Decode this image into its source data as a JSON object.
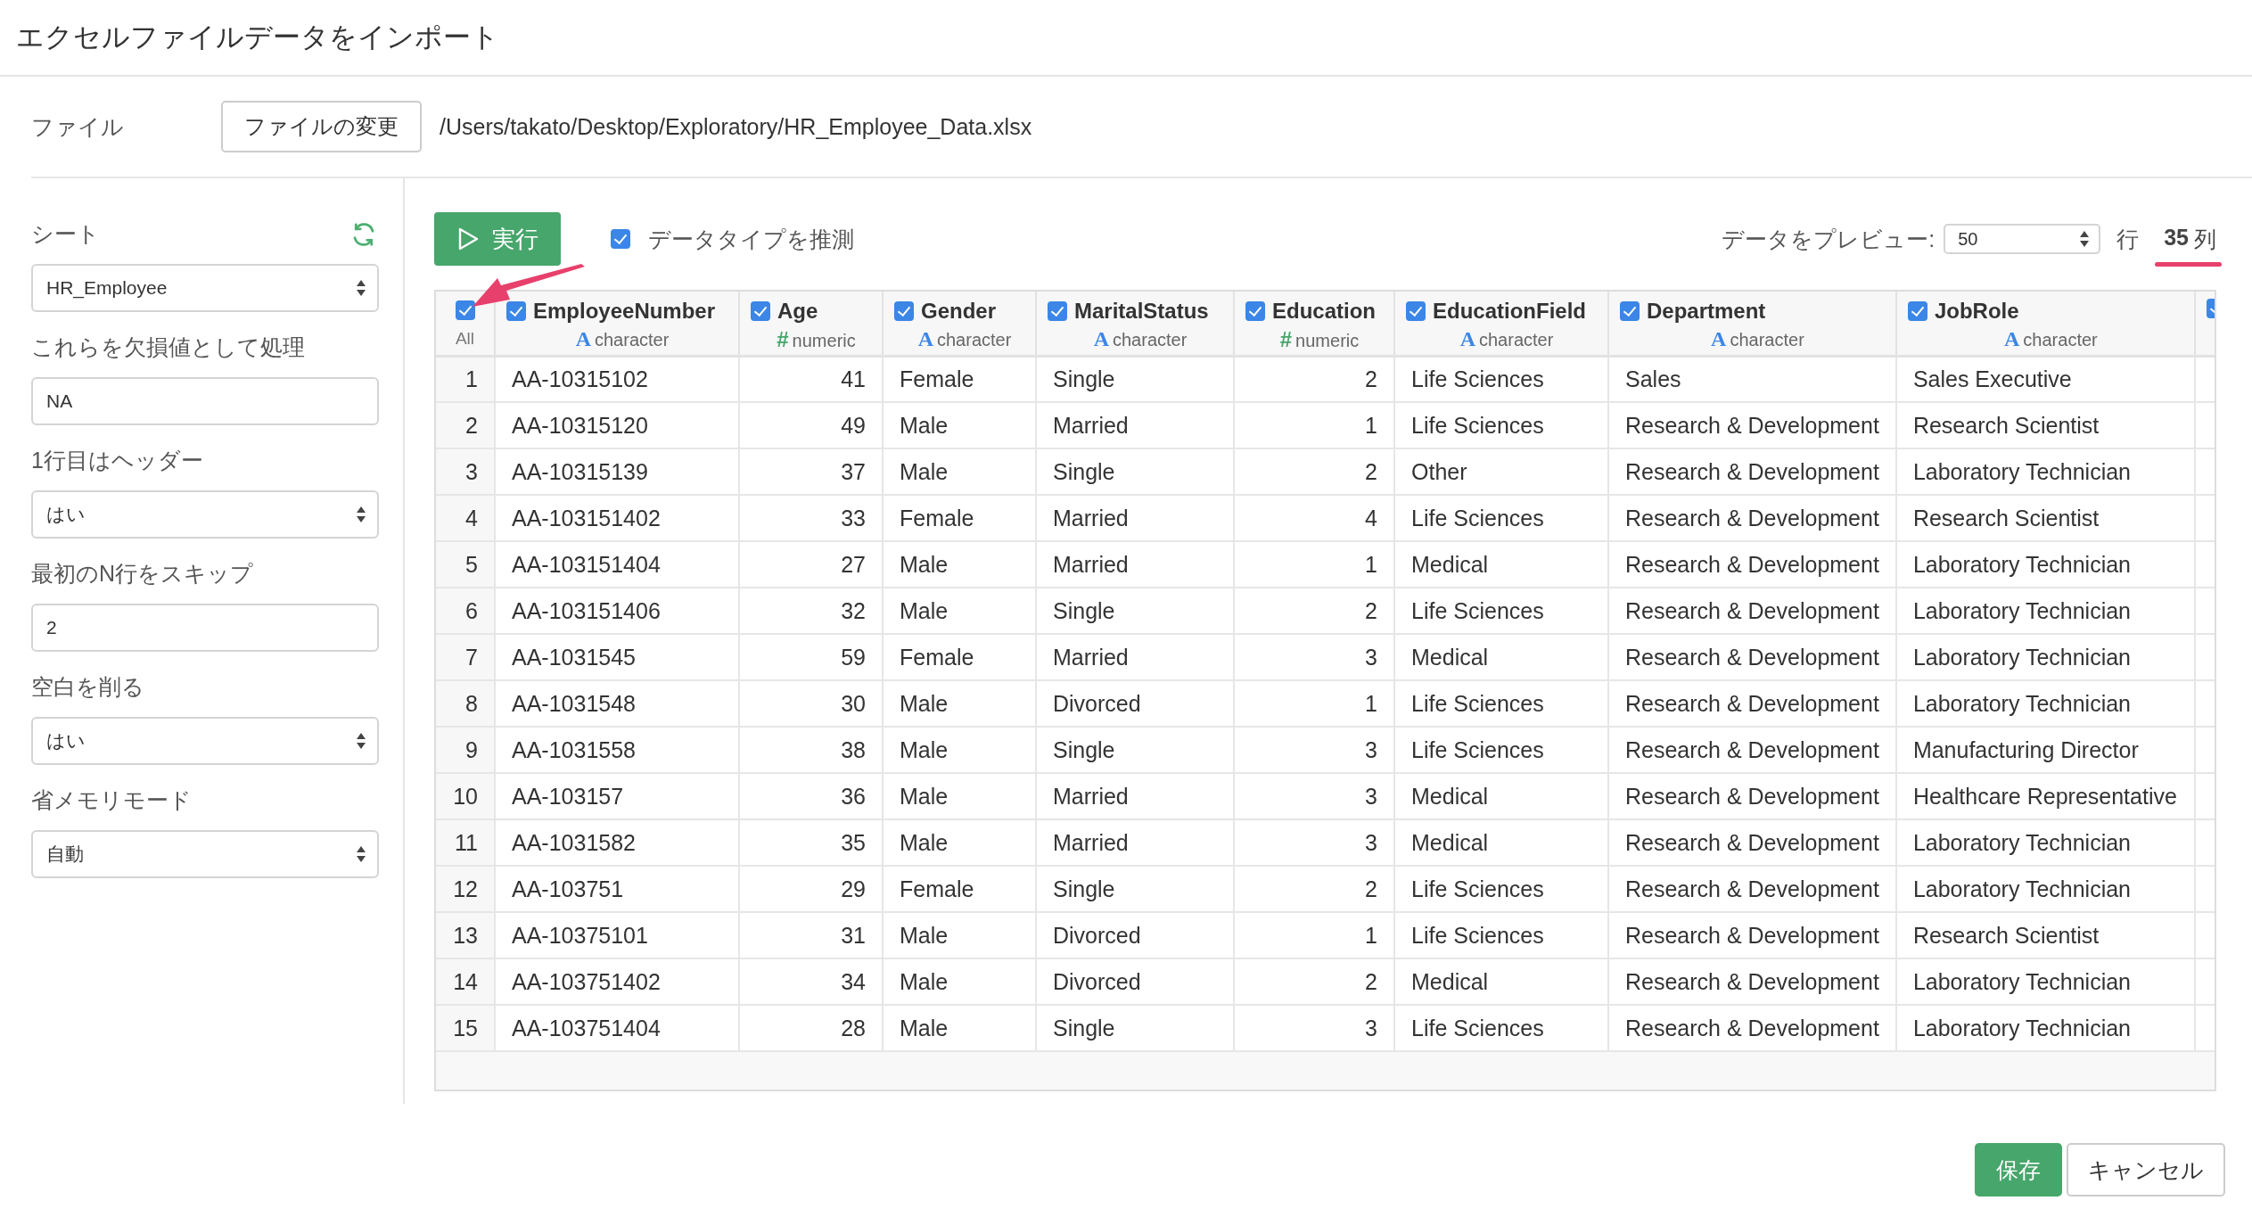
{
  "title": "エクセルファイルデータをインポート",
  "file": {
    "label": "ファイル",
    "button": "ファイルの変更",
    "path": "/Users/takato/Desktop/Exploratory/HR_Employee_Data.xlsx"
  },
  "sidebar": {
    "fields": [
      {
        "label": "シート",
        "kind": "select",
        "value": "HR_Employee"
      },
      {
        "label": "これらを欠損値として処理",
        "kind": "input",
        "value": "NA"
      },
      {
        "label": "1行目はヘッダー",
        "kind": "select",
        "value": "はい"
      },
      {
        "label": "最初のN行をスキップ",
        "kind": "input",
        "value": "2"
      },
      {
        "label": "空白を削る",
        "kind": "select",
        "value": "はい"
      },
      {
        "label": "省メモリモード",
        "kind": "select",
        "value": "自動"
      }
    ]
  },
  "toolbar": {
    "run_button": "実行",
    "guess_types": {
      "label": "データタイプを推測",
      "checked": true
    },
    "preview_label": "データをプレビュー:",
    "preview_value": "50",
    "rows_unit": "行",
    "column_count": "35",
    "columns_unit": "列"
  },
  "table": {
    "columns": [
      {
        "kind": "index",
        "name": "All",
        "checked": true
      },
      {
        "kind": "data",
        "name": "EmployeeNumber",
        "type_icon": "A",
        "type": "character",
        "checked": true
      },
      {
        "kind": "data",
        "name": "Age",
        "type_icon": "#",
        "type": "numeric",
        "checked": true
      },
      {
        "kind": "data",
        "name": "Gender",
        "type_icon": "A",
        "type": "character",
        "checked": true
      },
      {
        "kind": "data",
        "name": "MaritalStatus",
        "type_icon": "A",
        "type": "character",
        "checked": true
      },
      {
        "kind": "data",
        "name": "Education",
        "type_icon": "#",
        "type": "numeric",
        "checked": true
      },
      {
        "kind": "data",
        "name": "EducationField",
        "type_icon": "A",
        "type": "character",
        "checked": true
      },
      {
        "kind": "data",
        "name": "Department",
        "type_icon": "A",
        "type": "character",
        "checked": true
      },
      {
        "kind": "data",
        "name": "JobRole",
        "type_icon": "A",
        "type": "character",
        "checked": true
      },
      {
        "kind": "data",
        "checked": true
      }
    ],
    "rows": [
      [
        "1",
        "AA-10315102",
        "41",
        "Female",
        "Single",
        "2",
        "Life Sciences",
        "Sales",
        "Sales Executive"
      ],
      [
        "2",
        "AA-10315120",
        "49",
        "Male",
        "Married",
        "1",
        "Life Sciences",
        "Research & Development",
        "Research Scientist"
      ],
      [
        "3",
        "AA-10315139",
        "37",
        "Male",
        "Single",
        "2",
        "Other",
        "Research & Development",
        "Laboratory Technician"
      ],
      [
        "4",
        "AA-103151402",
        "33",
        "Female",
        "Married",
        "4",
        "Life Sciences",
        "Research & Development",
        "Research Scientist"
      ],
      [
        "5",
        "AA-103151404",
        "27",
        "Male",
        "Married",
        "1",
        "Medical",
        "Research & Development",
        "Laboratory Technician"
      ],
      [
        "6",
        "AA-103151406",
        "32",
        "Male",
        "Single",
        "2",
        "Life Sciences",
        "Research & Development",
        "Laboratory Technician"
      ],
      [
        "7",
        "AA-1031545",
        "59",
        "Female",
        "Married",
        "3",
        "Medical",
        "Research & Development",
        "Laboratory Technician"
      ],
      [
        "8",
        "AA-1031548",
        "30",
        "Male",
        "Divorced",
        "1",
        "Life Sciences",
        "Research & Development",
        "Laboratory Technician"
      ],
      [
        "9",
        "AA-1031558",
        "38",
        "Male",
        "Single",
        "3",
        "Life Sciences",
        "Research & Development",
        "Manufacturing Director"
      ],
      [
        "10",
        "AA-103157",
        "36",
        "Male",
        "Married",
        "3",
        "Medical",
        "Research & Development",
        "Healthcare Representative"
      ],
      [
        "11",
        "AA-1031582",
        "35",
        "Male",
        "Married",
        "3",
        "Medical",
        "Research & Development",
        "Laboratory Technician"
      ],
      [
        "12",
        "AA-103751",
        "29",
        "Female",
        "Single",
        "2",
        "Life Sciences",
        "Research & Development",
        "Laboratory Technician"
      ],
      [
        "13",
        "AA-10375101",
        "31",
        "Male",
        "Divorced",
        "1",
        "Life Sciences",
        "Research & Development",
        "Research Scientist"
      ],
      [
        "14",
        "AA-103751402",
        "34",
        "Male",
        "Divorced",
        "2",
        "Medical",
        "Research & Development",
        "Laboratory Technician"
      ],
      [
        "15",
        "AA-103751404",
        "28",
        "Male",
        "Single",
        "3",
        "Life Sciences",
        "Research & Development",
        "Laboratory Technician"
      ]
    ]
  },
  "footer": {
    "buttons": [
      {
        "label": "保存",
        "kind": "primary"
      },
      {
        "label": "キャンセル",
        "kind": "default"
      }
    ]
  }
}
